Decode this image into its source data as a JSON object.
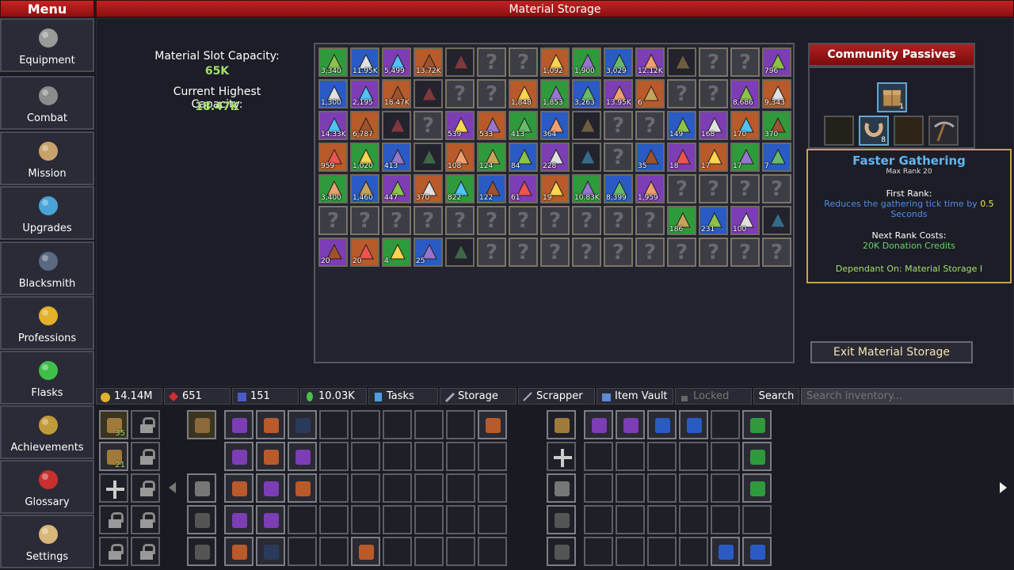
{
  "header": {
    "menu_title": "Menu",
    "page_title": "Material Storage"
  },
  "sidebar": {
    "items": [
      {
        "label": "Equipment",
        "icon": "helmet-icon",
        "color": "#9a9a9a"
      },
      {
        "label": "Combat",
        "icon": "sword-icon",
        "color": "#8c8c8c"
      },
      {
        "label": "Mission",
        "icon": "scroll-icon",
        "color": "#c7a26a"
      },
      {
        "label": "Upgrades",
        "icon": "shield-icon",
        "color": "#4aa3d6"
      },
      {
        "label": "Blacksmith",
        "icon": "anvil-icon",
        "color": "#5a6a82"
      },
      {
        "label": "Professions",
        "icon": "wheat-icon",
        "color": "#e3b02c"
      },
      {
        "label": "Flasks",
        "icon": "flask-icon",
        "color": "#3fbf4a"
      },
      {
        "label": "Achievements",
        "icon": "chest-icon",
        "color": "#c09a3a"
      },
      {
        "label": "Glossary",
        "icon": "book-icon",
        "color": "#c83030"
      },
      {
        "label": "Settings",
        "icon": "hourglass-icon",
        "color": "#d7b77a"
      }
    ]
  },
  "capacity": {
    "slot_label": "Material Slot Capacity:",
    "slot_value": "65K",
    "highest_label": "Current Highest Capacity:",
    "highest_value": "18.47K"
  },
  "materials": [
    [
      "3,340",
      "11.95K",
      "5,499",
      "13.72K",
      "",
      "?",
      "?",
      "1,092",
      "1,900",
      "3,029",
      "12.12K",
      "",
      "?",
      "?",
      "796"
    ],
    [
      "1,300",
      "2,195",
      "18.47K",
      "",
      "?",
      "?",
      "1,848",
      "1,853",
      "3,263",
      "13.95K",
      "6",
      "?",
      "?",
      "8,686",
      "9,343"
    ],
    [
      "14.33K",
      "6,787",
      "",
      "?",
      "539",
      "533",
      "413",
      "364",
      "",
      "?",
      "?",
      "149",
      "168",
      "170",
      "370"
    ],
    [
      "959",
      "1,020",
      "413",
      "",
      "108",
      "124",
      "84",
      "228",
      "",
      "?",
      "35",
      "18",
      "17",
      "17",
      "7"
    ],
    [
      "3,400",
      "1,460",
      "447",
      "370",
      "822",
      "122",
      "61",
      "19",
      "10.83K",
      "8,399",
      "1,959",
      "?",
      "?",
      "?",
      "?"
    ],
    [
      "?",
      "?",
      "?",
      "?",
      "?",
      "?",
      "?",
      "?",
      "?",
      "?",
      "?",
      "186",
      "231",
      "100",
      ""
    ],
    [
      "20",
      "20",
      "4",
      "25",
      "",
      "?",
      "?",
      "?",
      "?",
      "?",
      "?",
      "?",
      "?",
      "?",
      "?"
    ]
  ],
  "community_passives": {
    "title": "Community Passives",
    "top_count": "1",
    "row_count": "8",
    "tooltip": {
      "name": "Faster Gathering",
      "max_rank": "Max Rank 20",
      "first_rank_label": "First Rank:",
      "first_rank_desc_a": "Reduces the gathering tick time by ",
      "first_rank_value": "0.5",
      "first_rank_desc_b": "Seconds",
      "next_cost_label": "Next Rank Costs:",
      "next_cost_value": "20K Donation Credits",
      "dependant": "Dependant On: Material Storage I"
    }
  },
  "exit_button": "Exit Material Storage",
  "bottom_bar": {
    "gold": "14.14M",
    "gems": "651",
    "tokens": "151",
    "credits": "10.03K",
    "tasks": "Tasks",
    "storage": "Storage",
    "scrapper": "Scrapper",
    "item_vault": "Item Vault",
    "locked": "Locked",
    "search": "Search",
    "search_placeholder": "Search inventory..."
  },
  "inventory": {
    "chest_counts": [
      "35",
      "21"
    ]
  },
  "colors": {
    "common": "#2f9a3c",
    "uncommon": "#2a5bc4",
    "rare": "#7c3db5",
    "epic": "#b85a2a",
    "dark": "#2a2a3a",
    "accent": "#a3e06a",
    "title_red": "#b01c1c"
  }
}
